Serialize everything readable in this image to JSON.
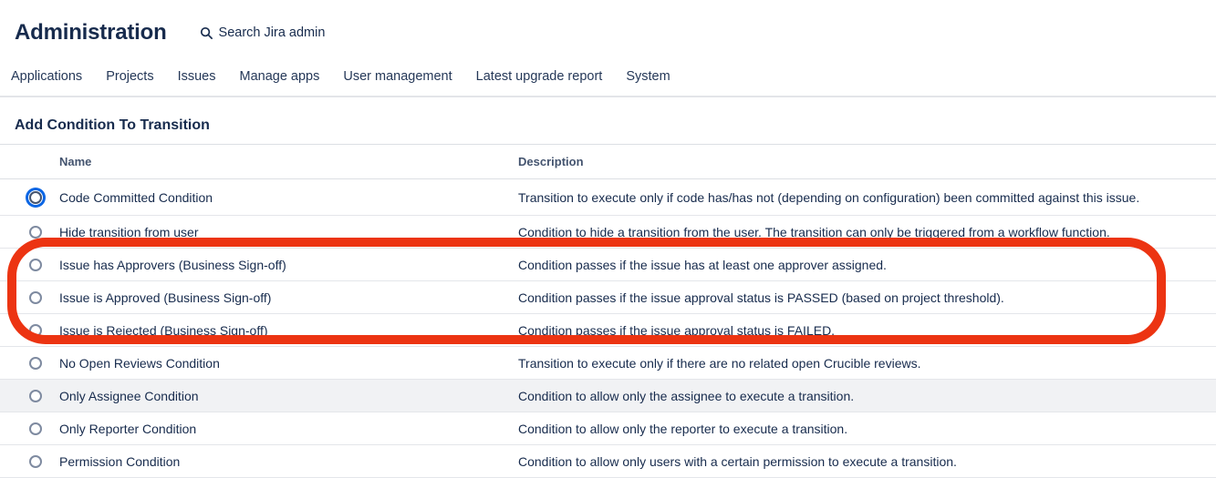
{
  "header": {
    "title": "Administration",
    "search_label": "Search Jira admin"
  },
  "nav": {
    "items": [
      {
        "label": "Applications"
      },
      {
        "label": "Projects"
      },
      {
        "label": "Issues"
      },
      {
        "label": "Manage apps"
      },
      {
        "label": "User management"
      },
      {
        "label": "Latest upgrade report"
      },
      {
        "label": "System"
      }
    ]
  },
  "page": {
    "title": "Add Condition To Transition"
  },
  "table": {
    "columns": {
      "name": "Name",
      "description": "Description"
    },
    "rows": [
      {
        "name": "Code Committed Condition",
        "description": "Transition to execute only if code has/has not (depending on configuration) been committed against this issue.",
        "focused": true,
        "striped": false
      },
      {
        "name": "Hide transition from user",
        "description": "Condition to hide a transition from the user. The transition can only be triggered from a workflow function.",
        "focused": false,
        "striped": false
      },
      {
        "name": "Issue has Approvers (Business Sign-off)",
        "description": "Condition passes if the issue has at least one approver assigned.",
        "focused": false,
        "striped": false
      },
      {
        "name": "Issue is Approved (Business Sign-off)",
        "description": "Condition passes if the issue approval status is PASSED (based on project threshold).",
        "focused": false,
        "striped": false
      },
      {
        "name": "Issue is Rejected (Business Sign-off)",
        "description": "Condition passes if the issue approval status is FAILED.",
        "focused": false,
        "striped": false
      },
      {
        "name": "No Open Reviews Condition",
        "description": "Transition to execute only if there are no related open Crucible reviews.",
        "focused": false,
        "striped": false
      },
      {
        "name": "Only Assignee Condition",
        "description": "Condition to allow only the assignee to execute a transition.",
        "focused": false,
        "striped": true
      },
      {
        "name": "Only Reporter Condition",
        "description": "Condition to allow only the reporter to execute a transition.",
        "focused": false,
        "striped": false
      },
      {
        "name": "Permission Condition",
        "description": "Condition to allow only users with a certain permission to execute a transition.",
        "focused": false,
        "striped": false
      }
    ]
  },
  "annotation": {
    "shape": "red-rounded-oval",
    "color": "#EC3412",
    "highlighted_rows": [
      "Issue has Approvers (Business Sign-off)",
      "Issue is Approved (Business Sign-off)",
      "Issue is Rejected (Business Sign-off)"
    ]
  },
  "colors": {
    "text_primary": "#172B4D",
    "column_header_text": "#44546F",
    "focus_ring_blue": "#0C66E4",
    "annotation_red": "#EC3412",
    "row_stripe": "#F1F2F4",
    "divider": "#DFE1E6"
  }
}
